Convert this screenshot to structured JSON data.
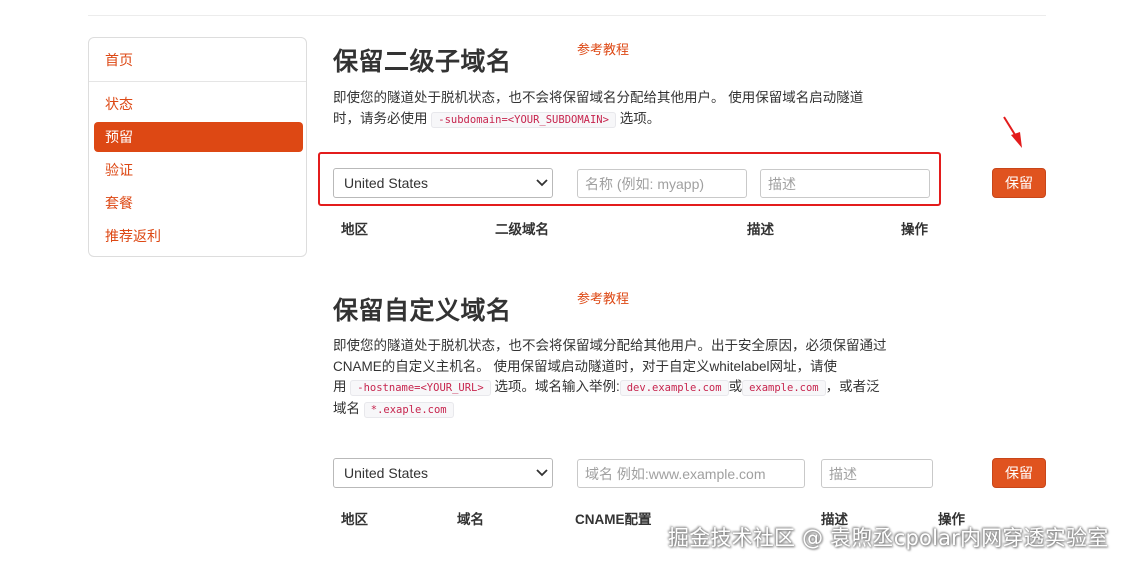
{
  "sidebar": {
    "items": [
      {
        "label": "首页"
      },
      {
        "label": "状态"
      },
      {
        "label": "预留"
      },
      {
        "label": "验证"
      },
      {
        "label": "套餐"
      },
      {
        "label": "推荐返利"
      }
    ],
    "active_index": 2
  },
  "subdomain_section": {
    "title": "保留二级子域名",
    "ref_link": "参考教程",
    "desc": {
      "line1": "即使您的隧道处于脱机状态，也不会将保留域名分配给其他用户。 使用保留域名启动隧道",
      "line2_prefix": "时，请务必使用",
      "code": "-subdomain=<YOUR_SUBDOMAIN>",
      "line2_suffix": "选项。"
    },
    "form": {
      "region_value": "United States",
      "name_placeholder": "名称 (例如: myapp)",
      "desc_placeholder": "描述",
      "save_label": "保留"
    },
    "columns": [
      "地区",
      "二级域名",
      "描述",
      "操作"
    ]
  },
  "custom_section": {
    "title": "保留自定义域名",
    "ref_link": "参考教程",
    "desc": {
      "line1": "即使您的隧道处于脱机状态，也不会将保留域分配给其他用户。出于安全原因，必须保留通过",
      "line2": "CNAME的自定义主机名。 使用保留域启动隧道时，对于自定义whitelabel网址，请使",
      "line3_prefix": "用",
      "code1": "-hostname=<YOUR_URL>",
      "line3_mid": "选项。域名输入举例:",
      "code2": "dev.example.com",
      "line3_or": "或",
      "code3": "example.com",
      "line3_suffix": "，或者泛",
      "line4_prefix": "域名",
      "code4": "*.exaple.com"
    },
    "form": {
      "region_value": "United States",
      "domain_placeholder": "域名 例如:www.example.com",
      "desc_placeholder": "描述",
      "save_label": "保留"
    },
    "columns": [
      "地区",
      "域名",
      "CNAME配置",
      "描述",
      "操作"
    ]
  },
  "watermark": "掘金技术社区 @ 袁煦丞cpolar内网穿透实验室",
  "colors": {
    "accent": "#dd4814",
    "button": "#e0531f",
    "highlight": "#e31c1c",
    "code_text": "#c7254e"
  }
}
